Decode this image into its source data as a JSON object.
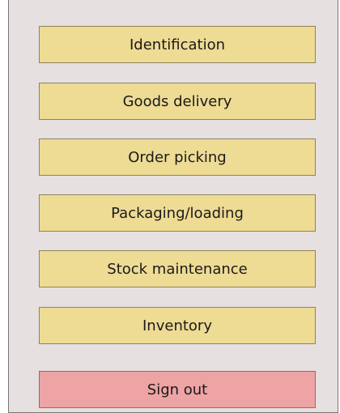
{
  "menu": {
    "items": [
      {
        "label": "Identification"
      },
      {
        "label": "Goods delivery"
      },
      {
        "label": "Order picking"
      },
      {
        "label": "Packaging/loading"
      },
      {
        "label": "Stock maintenance"
      },
      {
        "label": "Inventory"
      }
    ],
    "sign_out_label": "Sign out"
  },
  "colors": {
    "menu_button": "#eedb94",
    "sign_out_button": "#eea3a5",
    "panel_background": "#e7e0e0"
  }
}
